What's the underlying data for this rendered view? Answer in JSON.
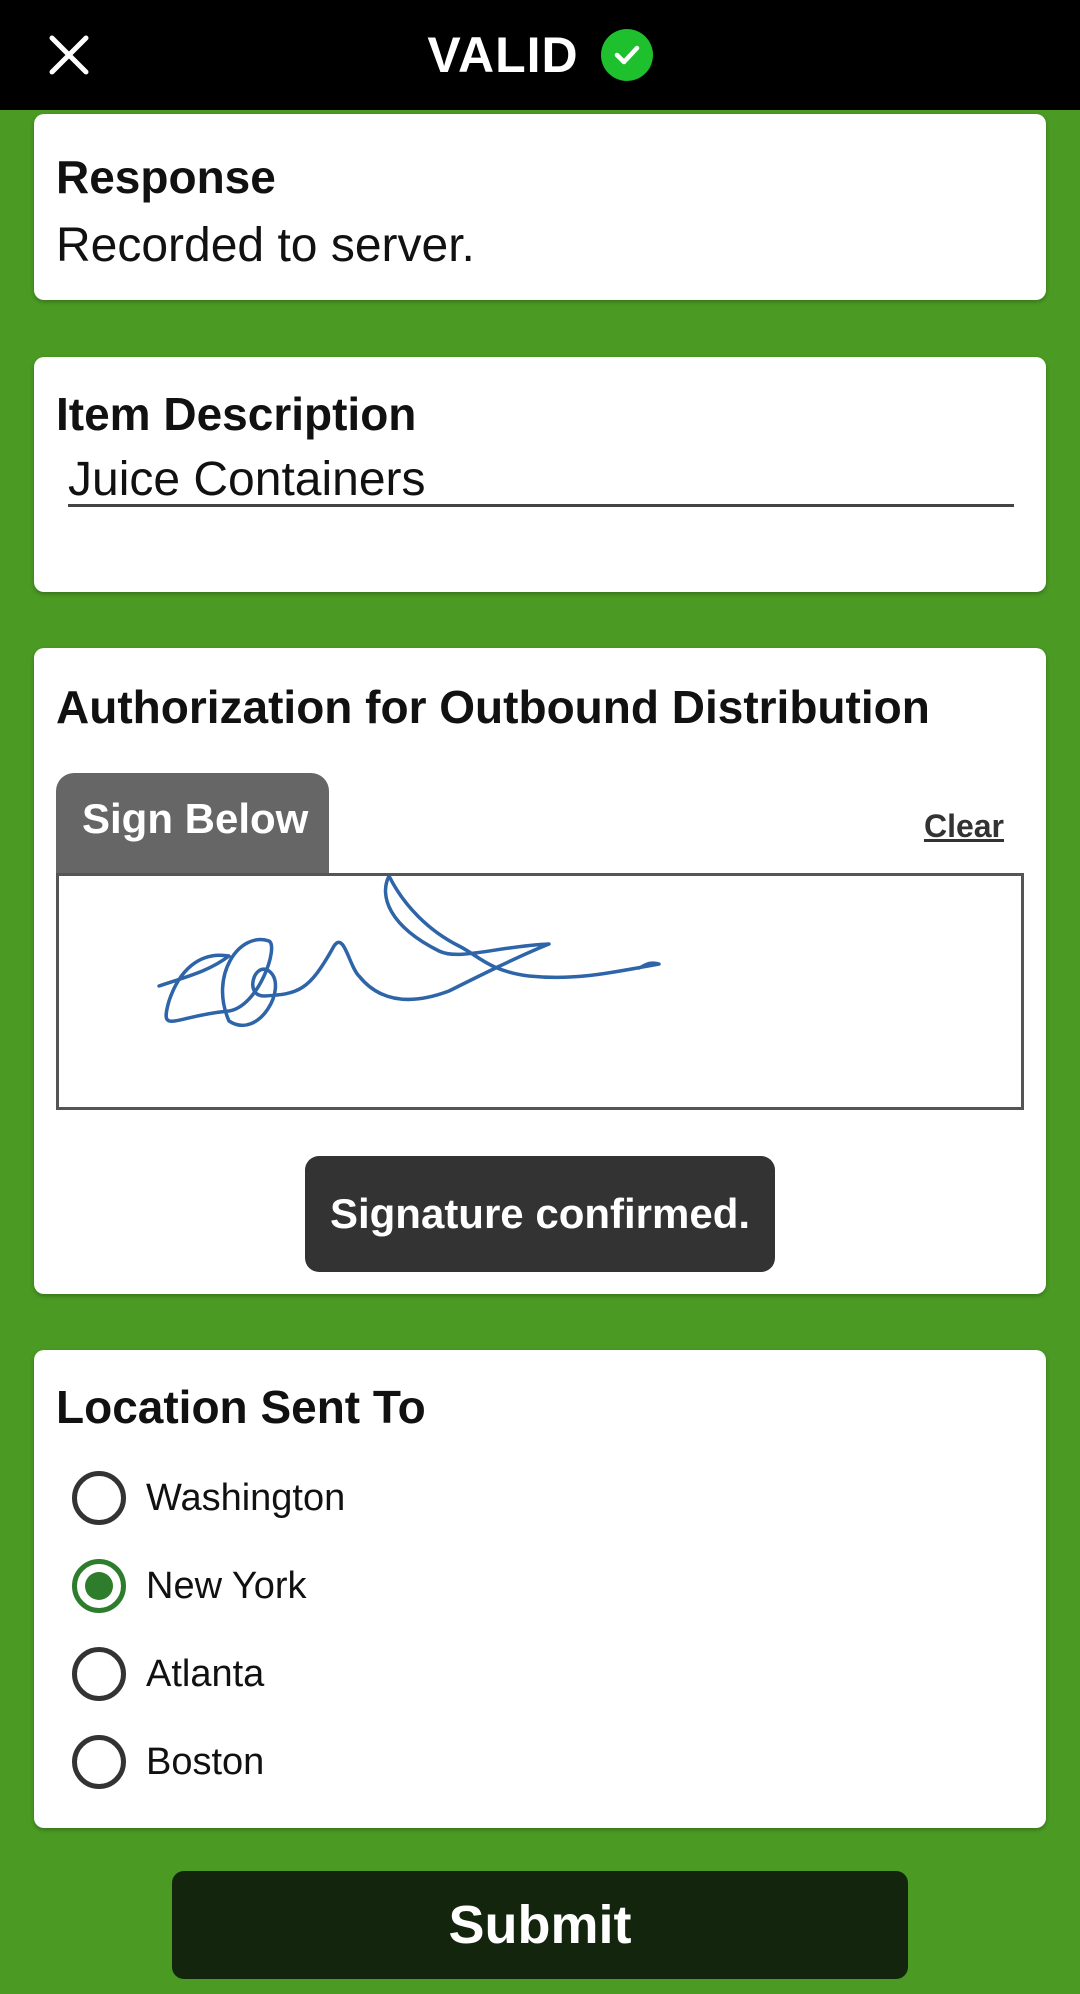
{
  "header": {
    "status": "VALID",
    "close_icon": "close-icon",
    "status_icon": "check-circle-icon",
    "status_color": "#1fc02d"
  },
  "response": {
    "title": "Response",
    "text": "Recorded to server."
  },
  "item": {
    "title": "Item Description",
    "value": "Juice Containers"
  },
  "authorization": {
    "title": "Authorization for Outbound Distribution",
    "tab_label": "Sign Below",
    "clear_label": "Clear",
    "toast": "Signature confirmed."
  },
  "location": {
    "title": "Location Sent To",
    "options": [
      {
        "label": "Washington",
        "checked": false
      },
      {
        "label": "New York",
        "checked": true
      },
      {
        "label": "Atlanta",
        "checked": false
      },
      {
        "label": "Boston",
        "checked": false
      }
    ]
  },
  "submit": {
    "label": "Submit"
  },
  "colors": {
    "background": "#4a9a24",
    "accent": "#2d7d2d",
    "submit": "#13250d",
    "signature_ink": "#2e64a8"
  }
}
